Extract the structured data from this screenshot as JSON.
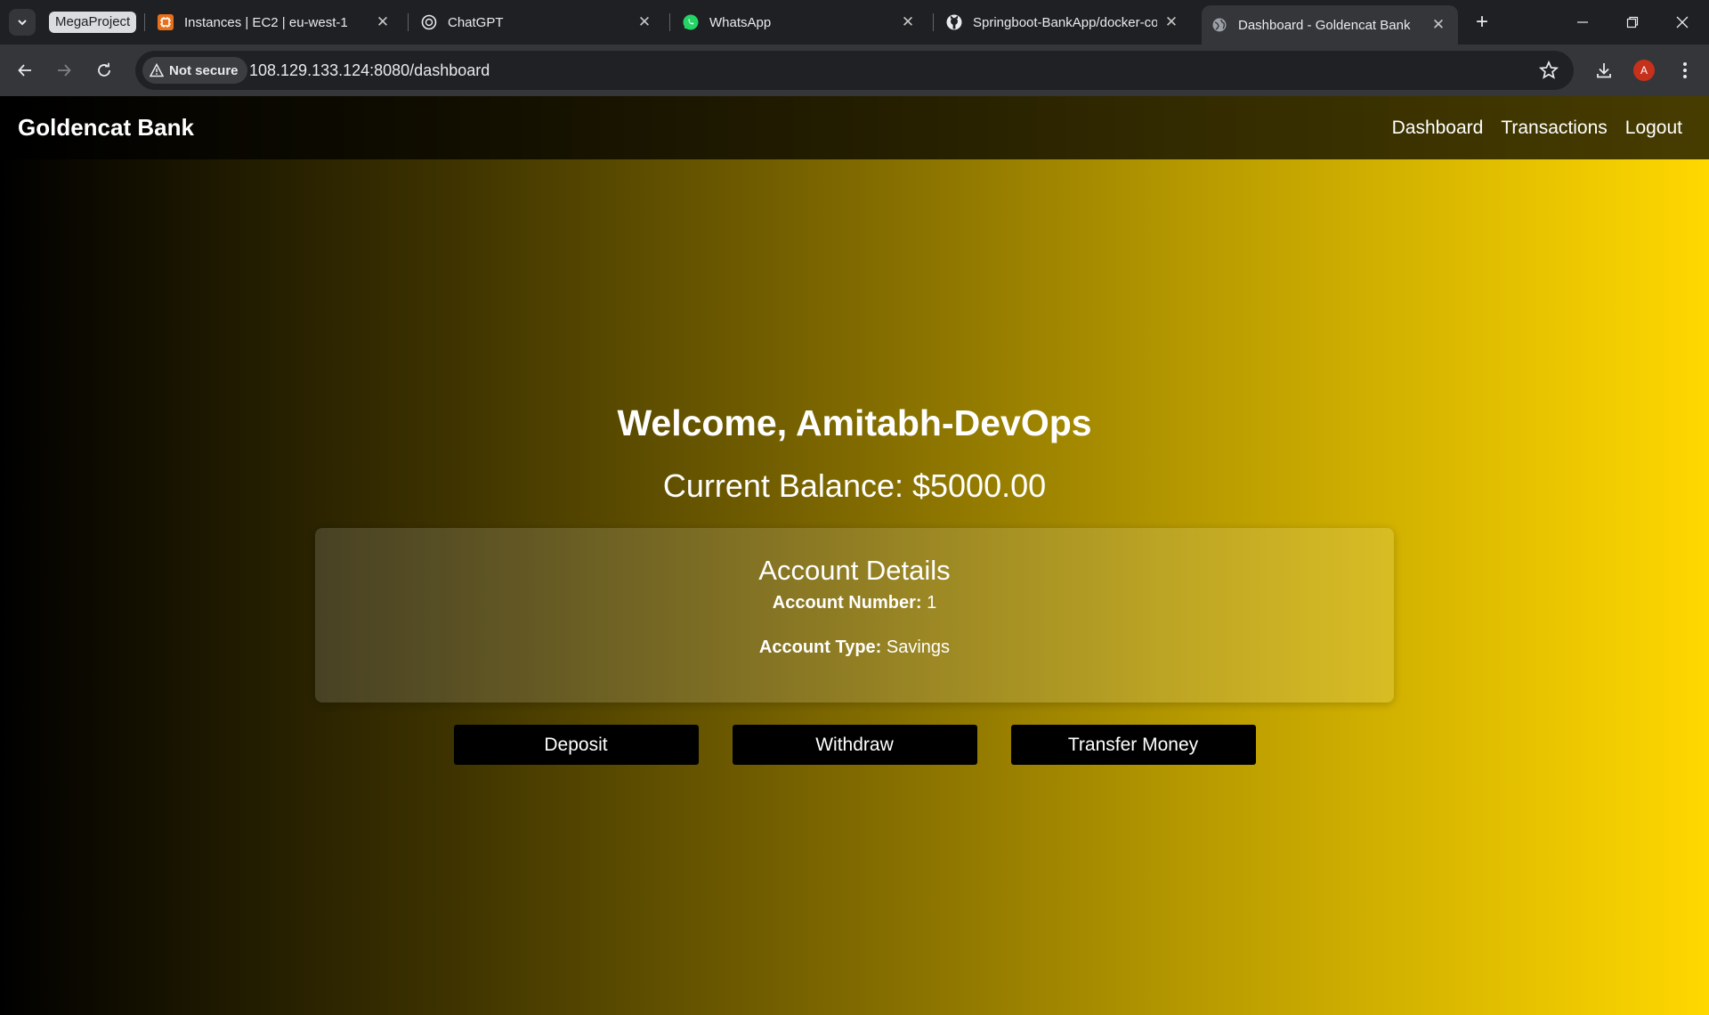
{
  "browser": {
    "tab_group": "MegaProject",
    "tabs": [
      {
        "title": "Instances | EC2 | eu-west-1",
        "icon": "aws-ec2-icon"
      },
      {
        "title": "ChatGPT",
        "icon": "chatgpt-icon"
      },
      {
        "title": "WhatsApp",
        "icon": "whatsapp-icon"
      },
      {
        "title": "Springboot-BankApp/docker-co",
        "icon": "github-icon"
      },
      {
        "title": "Dashboard - Goldencat Bank",
        "icon": "globe-icon",
        "active": true
      }
    ],
    "security_label": "Not secure",
    "url": "108.129.133.124:8080/dashboard",
    "profile_initial": "A"
  },
  "site": {
    "brand": "Goldencat Bank",
    "nav": {
      "dashboard": "Dashboard",
      "transactions": "Transactions",
      "logout": "Logout"
    }
  },
  "dashboard": {
    "welcome": "Welcome, Amitabh-DevOps",
    "balance": "Current Balance: $5000.00",
    "account": {
      "heading": "Account Details",
      "number_label": "Account Number:",
      "number_value": " 1",
      "type_label": "Account Type:",
      "type_value": " Savings"
    },
    "actions": {
      "deposit": "Deposit",
      "withdraw": "Withdraw",
      "transfer": "Transfer Money"
    }
  },
  "colors": {
    "gradient_start": "#000000",
    "gradient_end": "#ffd800",
    "button": "#000000"
  }
}
